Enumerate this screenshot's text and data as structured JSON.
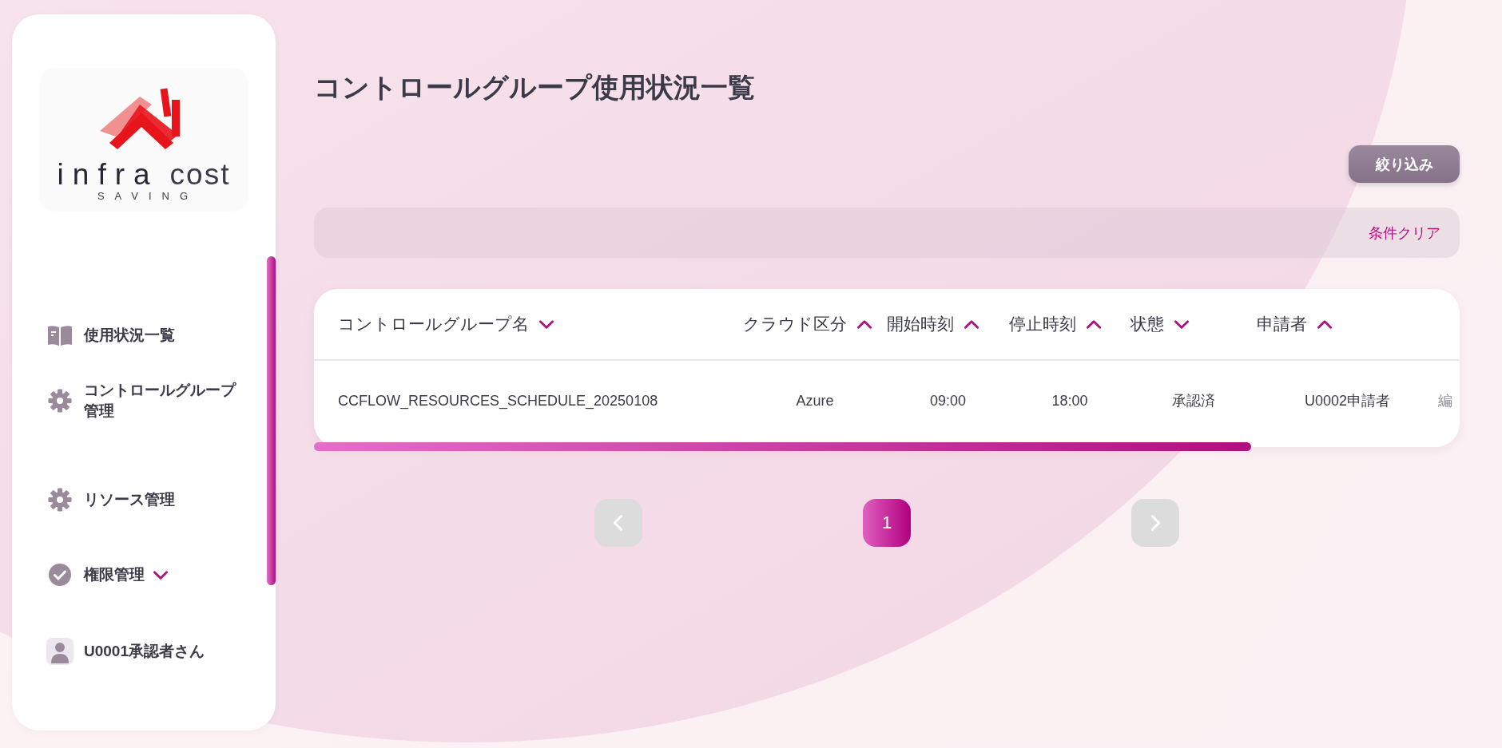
{
  "sidebar": {
    "logo": {
      "word1": "infra",
      "word2": "cost",
      "tagline": "SAVING"
    },
    "items": [
      {
        "label": "使用状況一覧"
      },
      {
        "label": "コントロールグループ管理"
      },
      {
        "label": "リソース管理"
      },
      {
        "label": "権限管理",
        "expanded": false
      },
      {
        "label": "U0001承認者さん"
      }
    ]
  },
  "page_title": "コントロールグループ使用状況一覧",
  "filter_button": "絞り込み",
  "clear_link": "条件クリア",
  "table": {
    "columns": [
      {
        "label": "コントロールグループ名",
        "ascending": false
      },
      {
        "label": "クラウド区分",
        "ascending": true
      },
      {
        "label": "開始時刻",
        "ascending": true
      },
      {
        "label": "停止時刻",
        "ascending": true
      },
      {
        "label": "状態",
        "ascending": false
      },
      {
        "label": "申請者",
        "ascending": true
      }
    ],
    "rows": [
      {
        "cells": [
          "CCFLOW_RESOURCES_SCHEDULE_20250108",
          "Azure",
          "09:00",
          "18:00",
          "承認済",
          "U0002申請者",
          "編"
        ]
      }
    ]
  },
  "pagination": {
    "prev": {
      "disabled": true
    },
    "pages": [
      {
        "label": "1",
        "selected": true
      }
    ],
    "next": {
      "disabled": true
    }
  }
}
